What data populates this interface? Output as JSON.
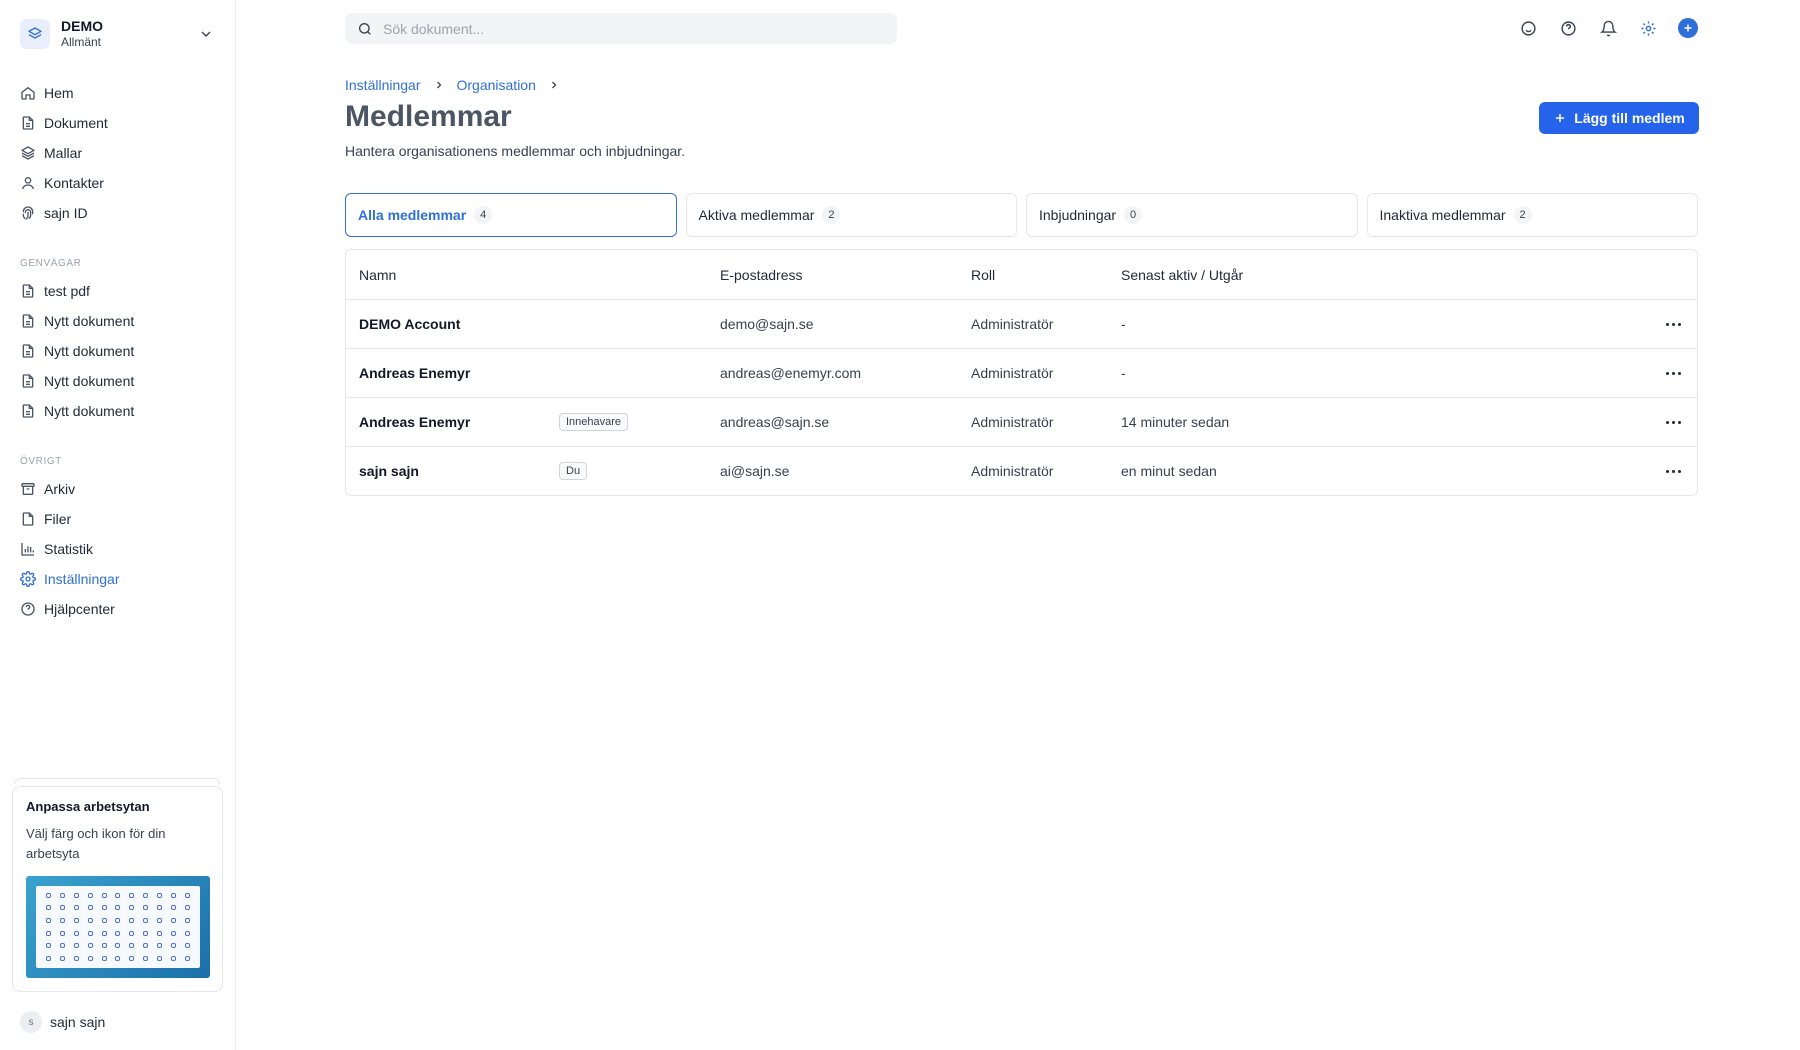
{
  "workspace": {
    "name": "DEMO",
    "sub": "Allmänt"
  },
  "nav": {
    "main": [
      {
        "label": "Hem",
        "icon": "home-icon"
      },
      {
        "label": "Dokument",
        "icon": "document-icon"
      },
      {
        "label": "Mallar",
        "icon": "layers-icon"
      },
      {
        "label": "Kontakter",
        "icon": "user-icon"
      },
      {
        "label": "sajn ID",
        "icon": "fingerprint-icon"
      }
    ],
    "shortcuts_label": "GENVÄGAR",
    "shortcuts": [
      {
        "label": "test pdf"
      },
      {
        "label": "Nytt dokument"
      },
      {
        "label": "Nytt dokument"
      },
      {
        "label": "Nytt dokument"
      },
      {
        "label": "Nytt dokument"
      }
    ],
    "other_label": "ÖVRIGT",
    "other": [
      {
        "label": "Arkiv",
        "icon": "archive-icon"
      },
      {
        "label": "Filer",
        "icon": "file-icon"
      },
      {
        "label": "Statistik",
        "icon": "bar-chart-icon"
      },
      {
        "label": "Inställningar",
        "icon": "gear-icon",
        "active": true
      },
      {
        "label": "Hjälpcenter",
        "icon": "help-circle-icon"
      }
    ]
  },
  "promo": {
    "title": "Anpassa arbetsytan",
    "description": "Välj färg och ikon för din arbetsyta"
  },
  "user": {
    "initial": "s",
    "name": "sajn sajn"
  },
  "search": {
    "placeholder": "Sök dokument..."
  },
  "breadcrumb": [
    "Inställningar",
    "Organisation"
  ],
  "page": {
    "title": "Medlemmar",
    "subtitle": "Hantera organisationens medlemmar och inbjudningar.",
    "add_button": "Lägg till medlem"
  },
  "tabs": [
    {
      "label": "Alla medlemmar",
      "count": "4",
      "active": true
    },
    {
      "label": "Aktiva medlemmar",
      "count": "2"
    },
    {
      "label": "Inbjudningar",
      "count": "0"
    },
    {
      "label": "Inaktiva medlemmar",
      "count": "2"
    }
  ],
  "table": {
    "columns": [
      "Namn",
      "E-postadress",
      "Roll",
      "Senast aktiv / Utgår"
    ],
    "rows": [
      {
        "name": "DEMO Account",
        "badge": "",
        "email": "demo@sajn.se",
        "role": "Administratör",
        "last": "-"
      },
      {
        "name": "Andreas Enemyr",
        "badge": "",
        "email": "andreas@enemyr.com",
        "role": "Administratör",
        "last": "-"
      },
      {
        "name": "Andreas Enemyr",
        "badge": "Innehavare",
        "email": "andreas@sajn.se",
        "role": "Administratör",
        "last": "14 minuter sedan"
      },
      {
        "name": "sajn sajn",
        "badge": "Du",
        "email": "ai@sajn.se",
        "role": "Administratör",
        "last": "en minut sedan"
      }
    ]
  },
  "colors": {
    "accent": "#2f6fd8",
    "button": "#2563eb"
  }
}
